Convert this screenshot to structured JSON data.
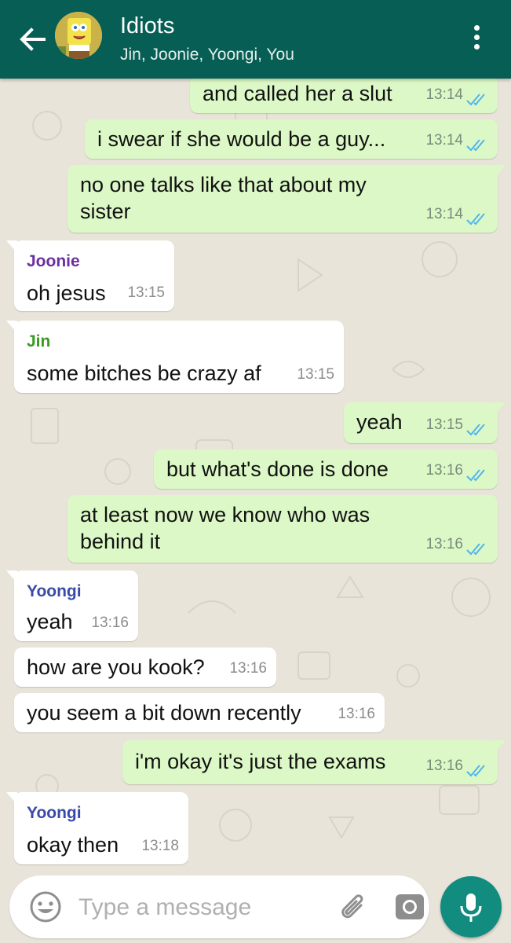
{
  "header": {
    "title": "Idiots",
    "subtitle": "Jin, Joonie, Yoongi, You"
  },
  "messages": [
    {
      "dir": "out",
      "text": "and called her a slut",
      "time": "13:14",
      "status": "read"
    },
    {
      "dir": "out",
      "text": "i swear if she would be a guy...",
      "time": "13:14",
      "status": "read"
    },
    {
      "dir": "out",
      "text": "no one talks like that about my sister",
      "time": "13:14",
      "status": "read"
    },
    {
      "dir": "in",
      "sender": "Joonie",
      "text": "oh jesus",
      "time": "13:15"
    },
    {
      "dir": "in",
      "sender": "Jin",
      "text": "some bitches be crazy af",
      "time": "13:15"
    },
    {
      "dir": "out",
      "text": "yeah",
      "time": "13:15",
      "status": "read"
    },
    {
      "dir": "out",
      "text": "but what's done is done",
      "time": "13:16",
      "status": "read"
    },
    {
      "dir": "out",
      "text": "at least now we know who was behind it",
      "time": "13:16",
      "status": "read"
    },
    {
      "dir": "in",
      "sender": "Yoongi",
      "text": "yeah",
      "time": "13:16"
    },
    {
      "dir": "in",
      "text": "how are you kook?",
      "time": "13:16"
    },
    {
      "dir": "in",
      "text": "you seem a bit down recently",
      "time": "13:16"
    },
    {
      "dir": "out",
      "text": "i'm okay it's just the exams",
      "time": "13:16",
      "status": "read"
    },
    {
      "dir": "in",
      "sender": "Yoongi",
      "text": "okay then",
      "time": "13:18"
    }
  ],
  "sender_colors": {
    "Joonie": "#6a2fa0",
    "Jin": "#3a9a22",
    "Yoongi": "#3a4aa8"
  },
  "composer": {
    "placeholder": "Type a message"
  },
  "icons": {
    "back": "arrow-left-icon",
    "menu": "more-vert-icon",
    "emoji": "emoji-icon",
    "attach": "paperclip-icon",
    "camera": "camera-icon",
    "mic": "microphone-icon",
    "read": "double-check-icon"
  },
  "colors": {
    "header": "#075e54",
    "outgoing_bubble": "#dcf8c6",
    "incoming_bubble": "#ffffff",
    "read_ticks": "#4fb6ec",
    "mic_button": "#128c7e"
  }
}
